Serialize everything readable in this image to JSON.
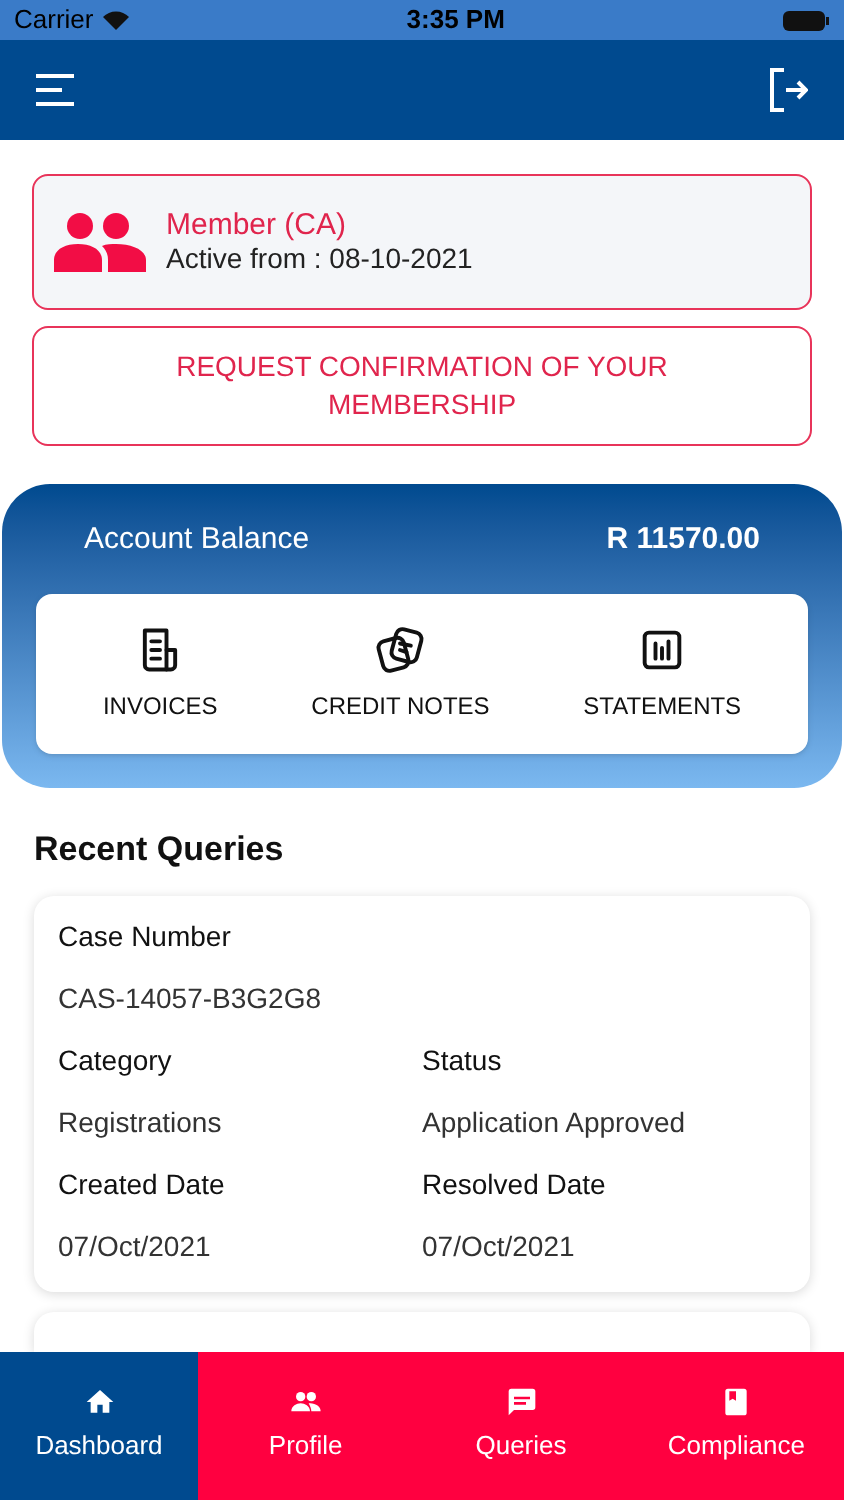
{
  "status_bar": {
    "carrier": "Carrier",
    "time": "3:35 PM"
  },
  "member": {
    "title": "Member (CA)",
    "active": "Active from : 08-10-2021"
  },
  "request_button": "REQUEST CONFIRMATION OF YOUR MEMBERSHIP",
  "balance": {
    "label": "Account Balance",
    "amount": "R 11570.00"
  },
  "shortcuts": [
    {
      "kind": "invoice",
      "label": "INVOICES"
    },
    {
      "kind": "notes",
      "label": "CREDIT NOTES"
    },
    {
      "kind": "chart",
      "label": "STATEMENTS"
    }
  ],
  "recent_queries": {
    "title": "Recent Queries",
    "cards": [
      {
        "case": {
          "label": "Case Number",
          "value": "CAS-14057-B3G2G8"
        },
        "fields": [
          {
            "label": "Category",
            "value": "Registrations"
          },
          {
            "label": "Status",
            "value": "Application Approved"
          },
          {
            "label": "Created Date",
            "value": "07/Oct/2021"
          },
          {
            "label": "Resolved Date",
            "value": "07/Oct/2021"
          }
        ]
      }
    ]
  },
  "tabs": [
    {
      "kind": "home",
      "label": "Dashboard",
      "selected": true
    },
    {
      "kind": "people",
      "label": "Profile",
      "selected": false
    },
    {
      "kind": "chat",
      "label": "Queries",
      "selected": false
    },
    {
      "kind": "book",
      "label": "Compliance",
      "selected": false
    }
  ]
}
